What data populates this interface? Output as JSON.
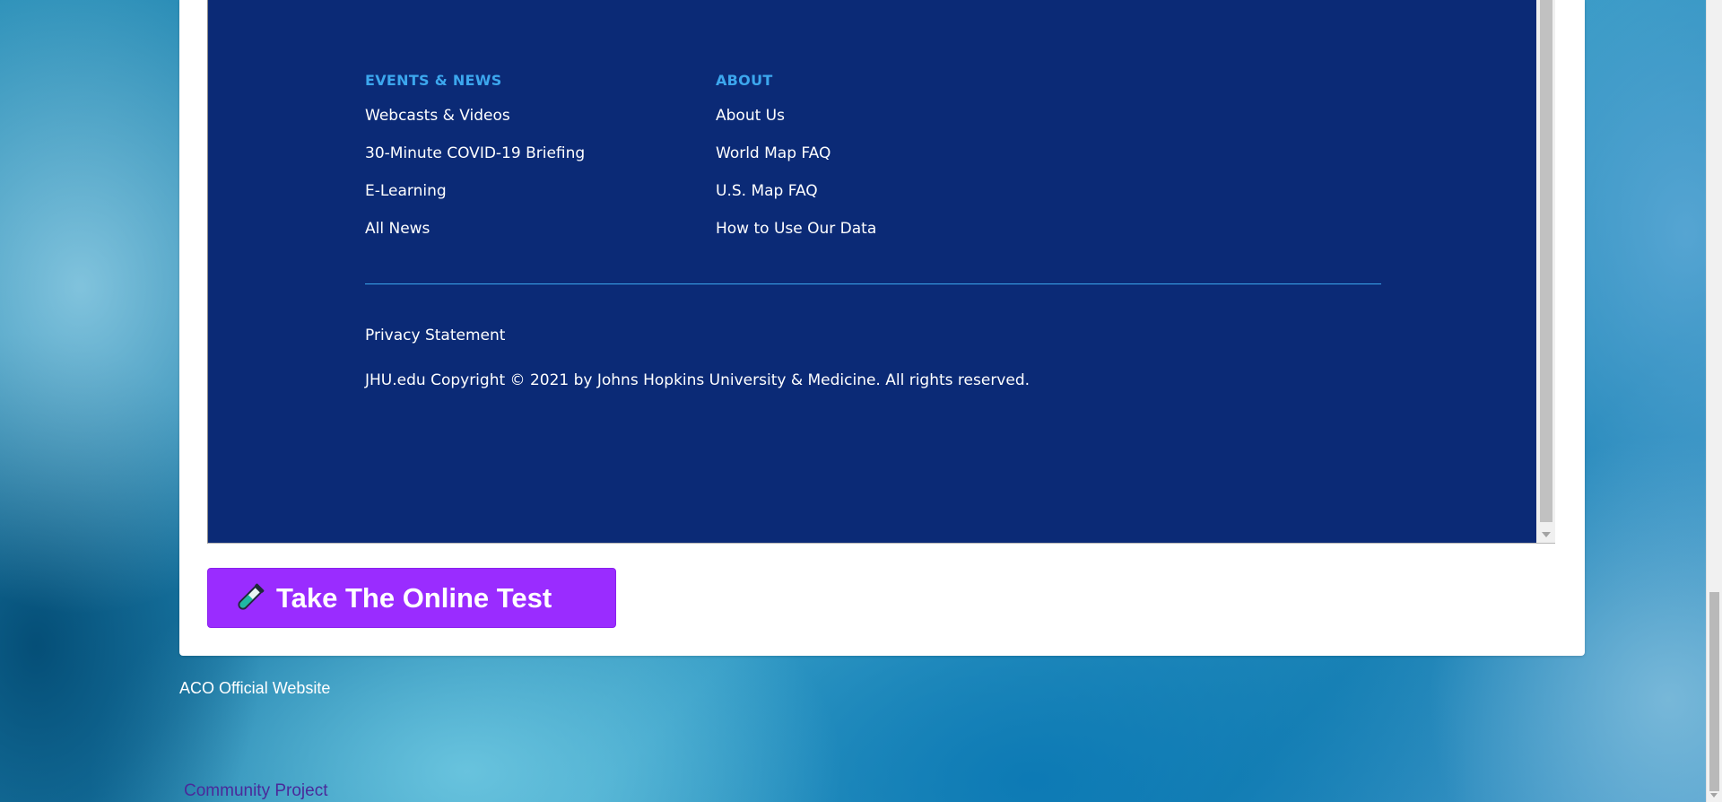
{
  "footer": {
    "events_news": {
      "heading": "EVENTS & NEWS",
      "links": [
        "Webcasts & Videos",
        "30-Minute COVID-19 Briefing",
        "E-Learning",
        "All News"
      ]
    },
    "about": {
      "heading": "ABOUT",
      "links": [
        "About Us",
        "World Map FAQ",
        "U.S. Map FAQ",
        "How to Use Our Data"
      ]
    },
    "privacy_label": "Privacy Statement",
    "copyright": "JHU.edu Copyright © 2021 by Johns Hopkins University & Medicine. All rights reserved.",
    "background_color": "#0b2a76",
    "heading_color": "#3ca7ee"
  },
  "cta": {
    "label": "Take The Online Test",
    "icon": "test-tube-icon",
    "color": "#9a2cff"
  },
  "page_links": {
    "aco_official": "ACO Official Website",
    "community_project": "Community Project"
  }
}
